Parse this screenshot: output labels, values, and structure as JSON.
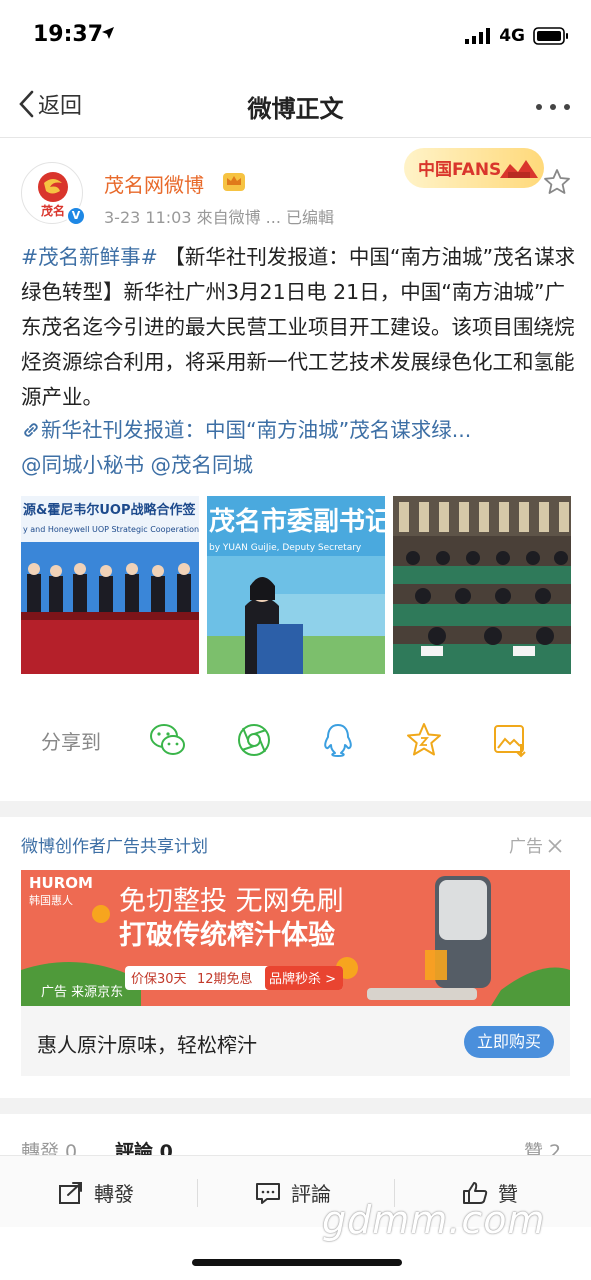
{
  "status": {
    "time": "19:37",
    "network": "4G"
  },
  "nav": {
    "back_label": "返回",
    "title": "微博正文"
  },
  "post": {
    "author": "茂名网微博",
    "avatar_text": "茂名",
    "meta": "3-23 11:03  來自微博 ...  已编輯",
    "fans_badge_text": "中国FANS",
    "hashtag": "#茂名新鲜事#",
    "body": " 【新华社刊发报道：中国“南方油城”茂名谋求绿色转型】新华社广州3月21日电 21日，中国“南方油城”广东茂名迄今引进的最大民营工业项目开工建设。该项目围绕烷烃资源综合利用，将采用新一代工艺技术发展绿色化工和氢能源产业。",
    "link": "新华社刊发报道：中国“南方油城”茂名谋求绿...",
    "mentions": [
      "@同城小秘书",
      "@茂名同城"
    ]
  },
  "photos": [
    {
      "banner_cn": "源&霍尼韦尔UOP战略合作签",
      "banner_en": "y and Honeywell UOP Strategic Cooperation Sign"
    },
    {
      "banner_cn": "茂名市委副书记",
      "banner_en": "by YUAN GuiJie, Deputy Secretary"
    },
    {
      "banner_cn": "",
      "banner_en": ""
    }
  ],
  "share": {
    "label": "分享到"
  },
  "ad": {
    "header": "微博创作者广告共享计划",
    "tag": "广告",
    "brand_en": "HUROM",
    "brand_cn": "韩国惠人",
    "headline1": "免切整投 无网免刷",
    "headline2": "打破传统榨汁体验",
    "pill1": "价保30天",
    "pill2": "12期免息",
    "pill3": "品牌秒杀 >",
    "source": "广告 来源京东",
    "caption": "惠人原汁原味，轻松榨汁",
    "cta": "立即购买"
  },
  "stats": {
    "repost": "轉發 0",
    "comment": "評論 0",
    "like": "贊 2"
  },
  "actions": {
    "repost": "轉發",
    "comment": "評論",
    "like": "贊"
  },
  "watermark": "gdmm.com",
  "colors": {
    "link": "#3d6fa5",
    "author": "#e86a2b",
    "ad_bg": "#ee6a52",
    "cta": "#4a8fdc"
  }
}
